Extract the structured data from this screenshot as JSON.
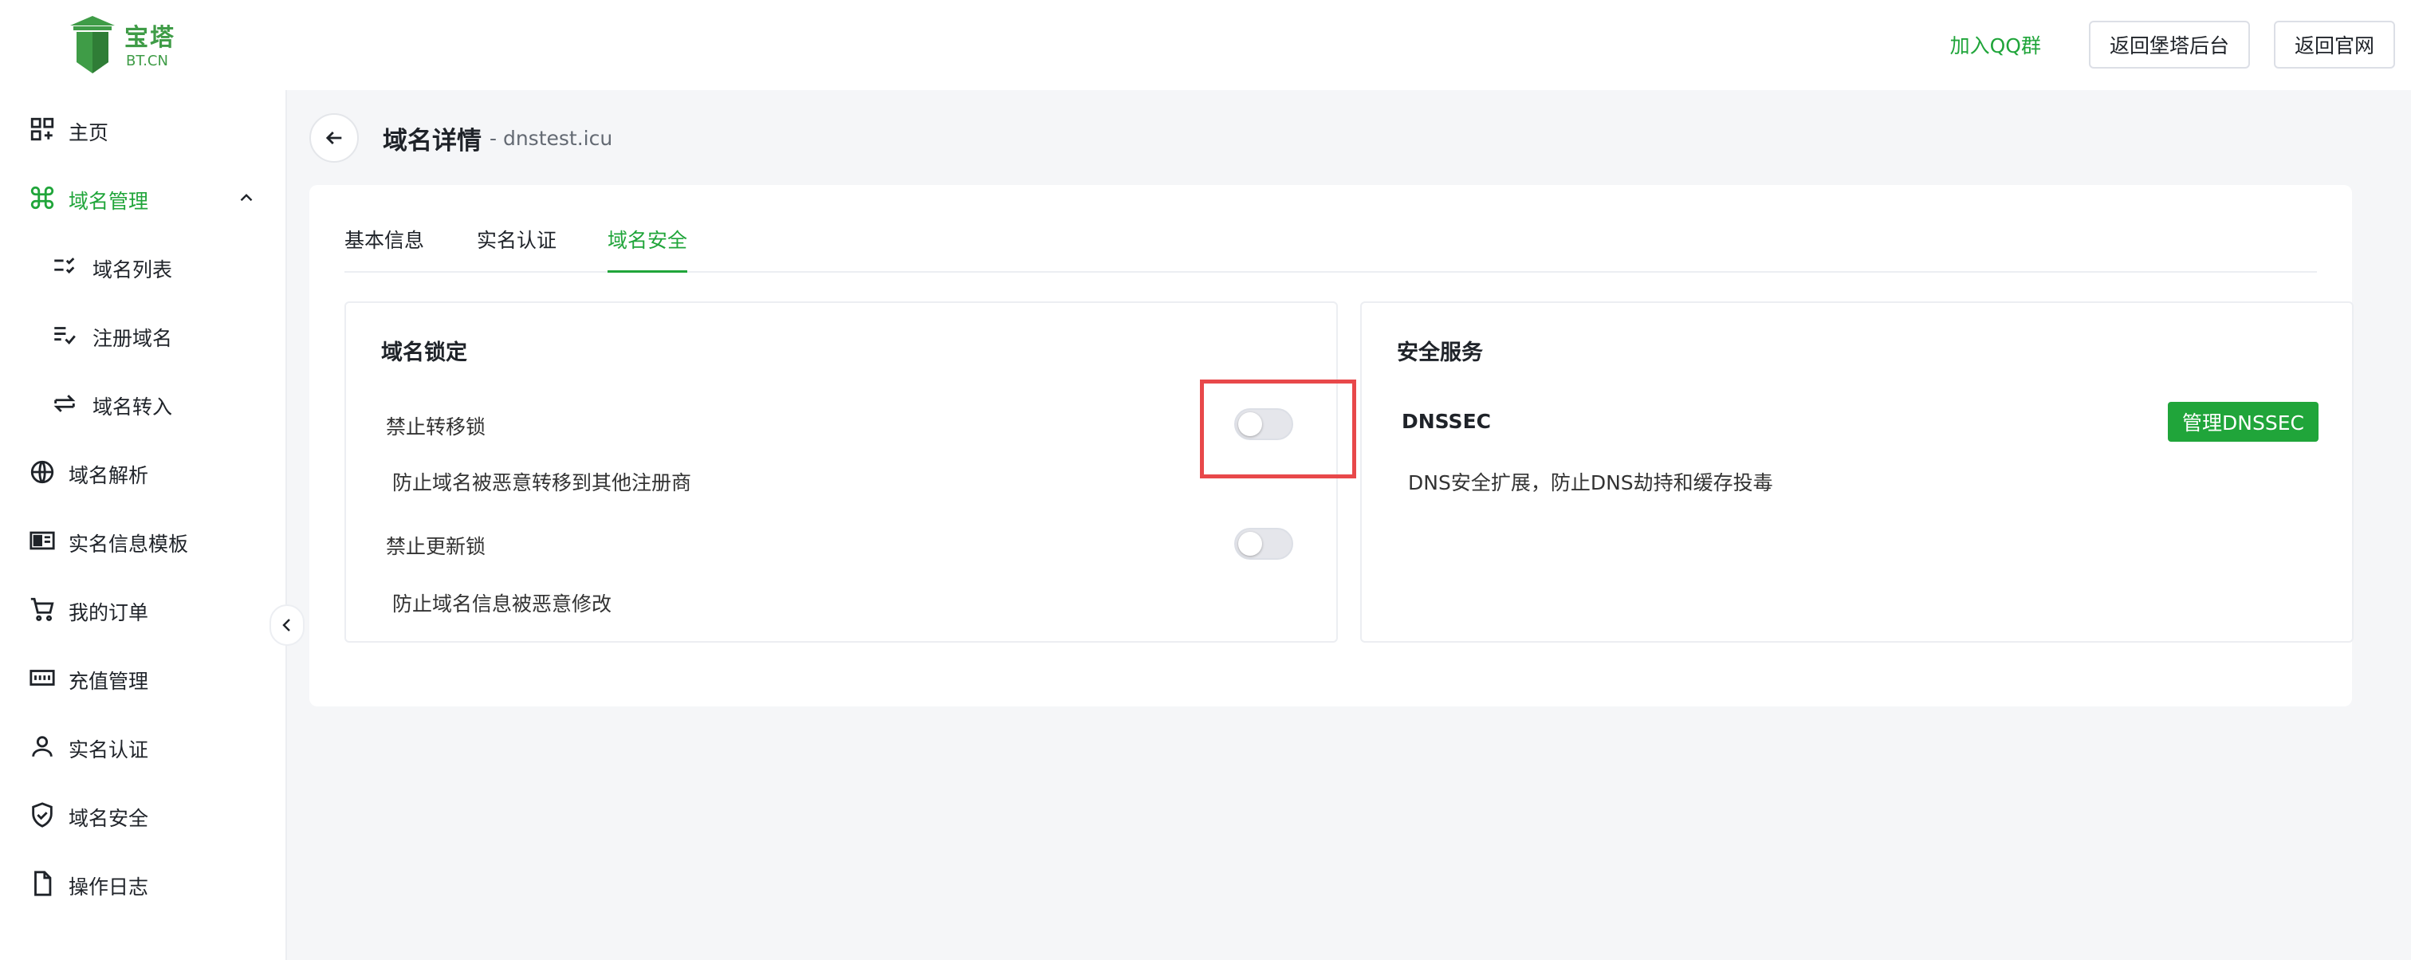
{
  "brand": {
    "name_cn": "宝塔",
    "name_en": "BT.CN",
    "accent": "#20a53a"
  },
  "top": {
    "qq_link": "加入QQ群",
    "buttons": [
      "返回堡塔后台",
      "返回官网"
    ]
  },
  "sidebar": {
    "items": [
      {
        "label": "主页",
        "icon": "dashboard-icon"
      },
      {
        "label": "域名管理",
        "icon": "command-icon",
        "active": true,
        "expanded": true
      },
      {
        "label": "域名列表",
        "icon": "list-check-icon",
        "sub": true
      },
      {
        "label": "注册域名",
        "icon": "list-add-icon",
        "sub": true
      },
      {
        "label": "域名转入",
        "icon": "transfer-icon",
        "sub": true
      },
      {
        "label": "域名解析",
        "icon": "globe-icon"
      },
      {
        "label": "实名信息模板",
        "icon": "id-card-icon"
      },
      {
        "label": "我的订单",
        "icon": "cart-icon"
      },
      {
        "label": "充值管理",
        "icon": "money-icon"
      },
      {
        "label": "实名认证",
        "icon": "user-icon"
      },
      {
        "label": "域名安全",
        "icon": "shield-icon"
      },
      {
        "label": "操作日志",
        "icon": "file-icon"
      }
    ]
  },
  "page": {
    "title": "域名详情",
    "subtitle": "- dnstest.icu"
  },
  "tabs": [
    {
      "label": "基本信息"
    },
    {
      "label": "实名认证"
    },
    {
      "label": "域名安全",
      "active": true
    }
  ],
  "lock_panel": {
    "title": "域名锁定",
    "rows": [
      {
        "label": "禁止转移锁",
        "desc": "防止域名被恶意转移到其他注册商",
        "enabled": false
      },
      {
        "label": "禁止更新锁",
        "desc": "防止域名信息被恶意修改",
        "enabled": false
      }
    ]
  },
  "security_panel": {
    "title": "安全服务",
    "dnssec_label": "DNSSEC",
    "manage_button": "管理DNSSEC",
    "desc": "DNS安全扩展，防止DNS劫持和缓存投毒"
  }
}
